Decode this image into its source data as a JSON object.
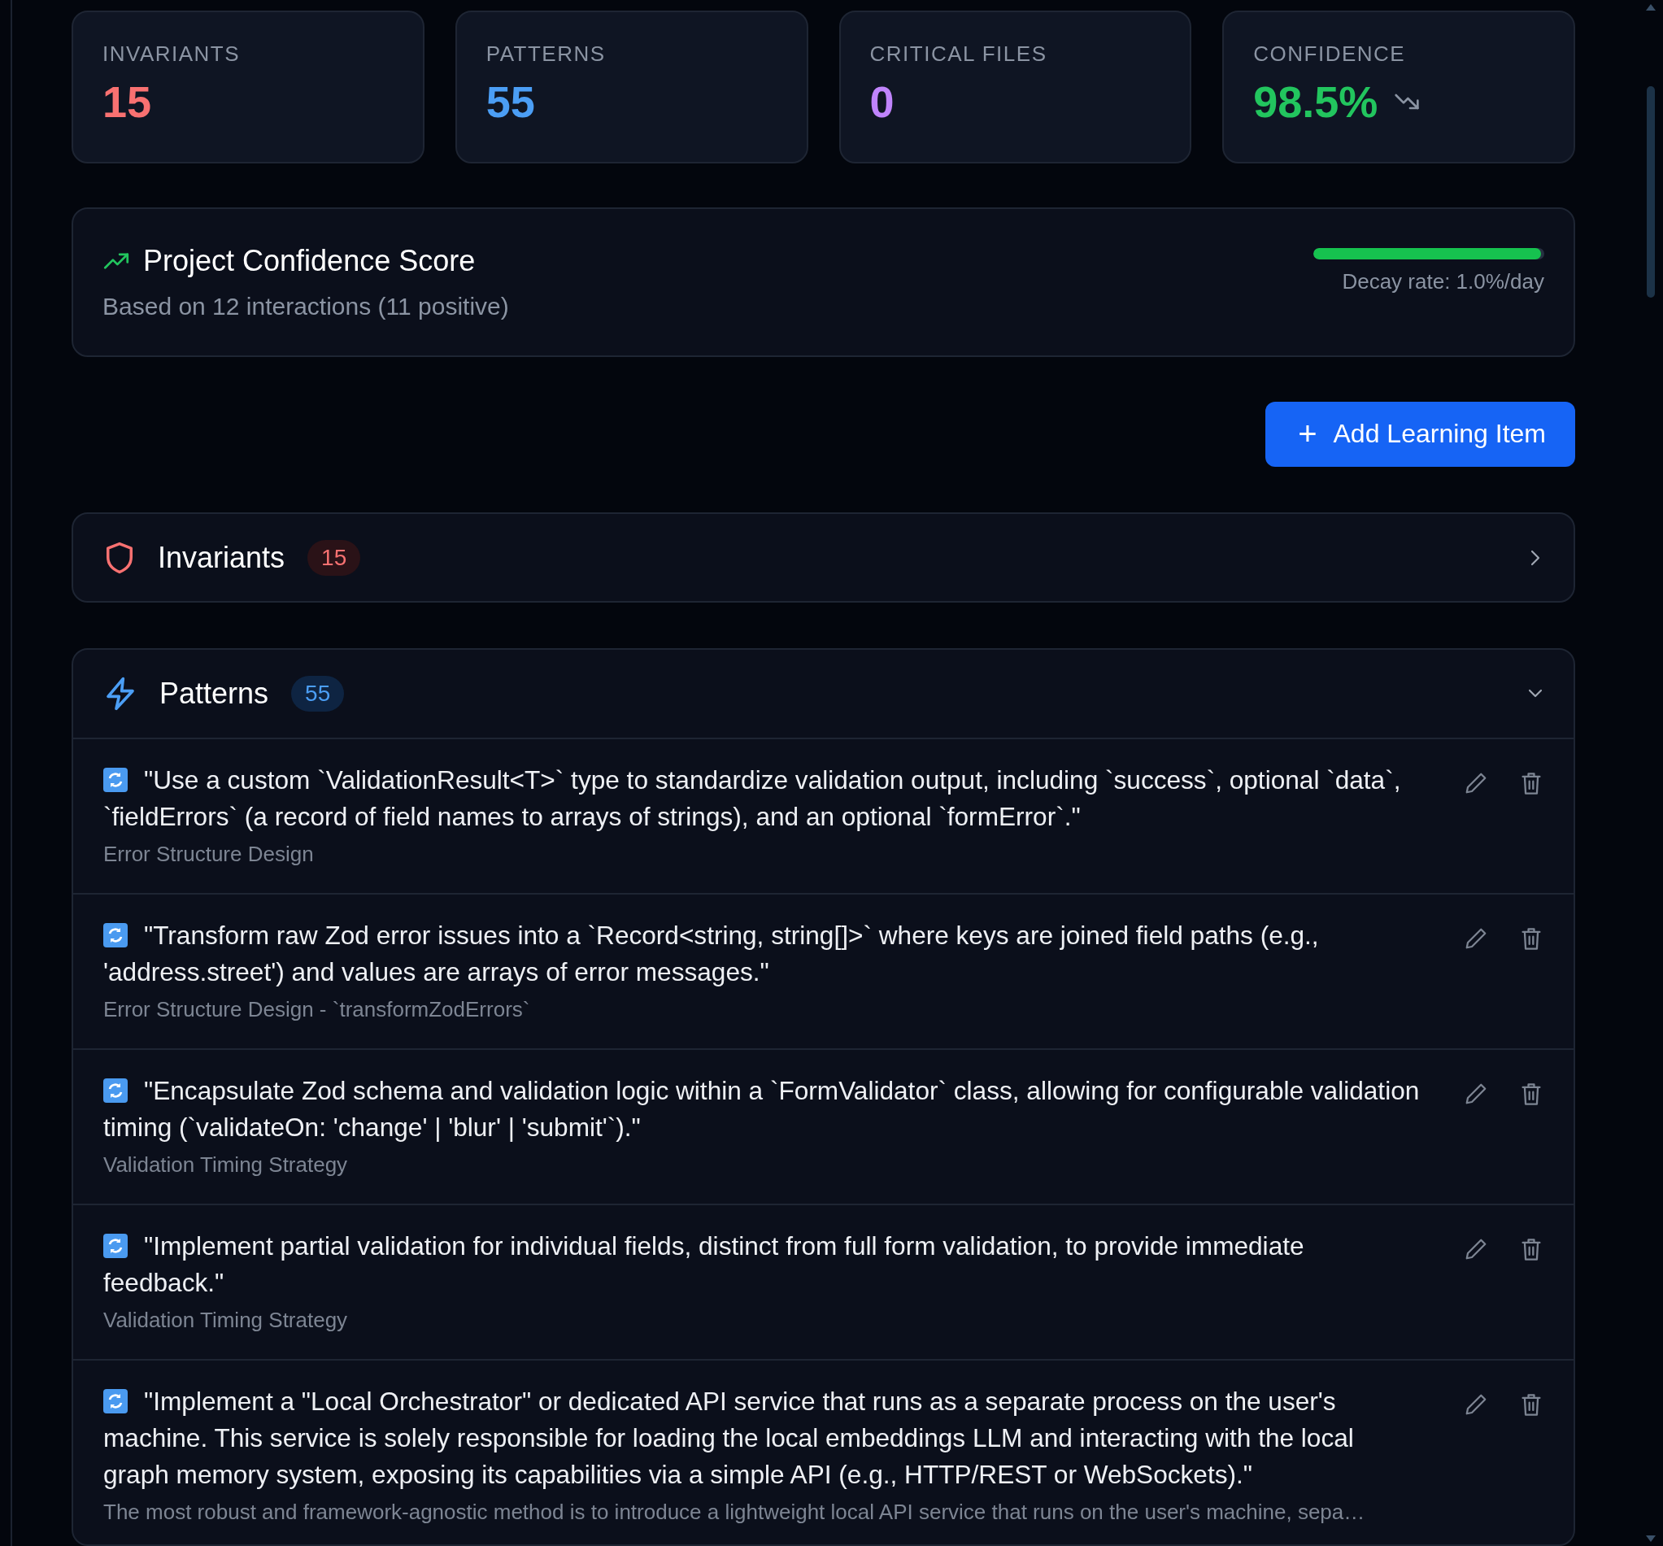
{
  "stats": [
    {
      "label": "INVARIANTS",
      "value": "15",
      "color": "#f87171"
    },
    {
      "label": "PATTERNS",
      "value": "55",
      "color": "#4b9ef5"
    },
    {
      "label": "CRITICAL FILES",
      "value": "0",
      "color": "#c084fc"
    },
    {
      "label": "CONFIDENCE",
      "value": "98.5%",
      "color": "#22c55e",
      "decaying": true
    }
  ],
  "confidence": {
    "title": "Project Confidence Score",
    "subtitle": "Based on 12 interactions (11 positive)",
    "level": 0.985,
    "decay": "Decay rate: 1.0%/day"
  },
  "add_button": {
    "icon": "+",
    "label": "Add Learning Item"
  },
  "sections": [
    {
      "kind": "invariants",
      "title": "Invariants",
      "count": "15",
      "expanded": false
    },
    {
      "kind": "patterns",
      "title": "Patterns",
      "count": "55",
      "expanded": true,
      "items": [
        {
          "text": "\"Use a custom `ValidationResult<T>` type to standardize validation output, including `success`, optional `data`, `fieldErrors` (a record of field names to arrays of strings), and an optional `formError`.\"",
          "source": "Error Structure Design"
        },
        {
          "text": "\"Transform raw Zod error issues into a `Record<string, string[]>` where keys are joined field paths (e.g., 'address.street') and values are arrays of error messages.\"",
          "source": "Error Structure Design - `transformZodErrors`"
        },
        {
          "text": "\"Encapsulate Zod schema and validation logic within a `FormValidator` class, allowing for configurable validation timing (`validateOn: 'change' | 'blur' | 'submit'`).\"",
          "source": "Validation Timing Strategy"
        },
        {
          "text": "\"Implement partial validation for individual fields, distinct from full form validation, to provide immediate feedback.\"",
          "source": "Validation Timing Strategy"
        },
        {
          "text": "\"Implement a \"Local Orchestrator\" or dedicated API service that runs as a separate process on the user's machine. This service is solely responsible for loading the local embeddings LLM and interacting with the local graph memory system, exposing its capabilities via a simple API (e.g., HTTP/REST or WebSockets).\"",
          "source": "The most robust and framework-agnostic method is to introduce a lightweight local API service that runs on the user's machine, sepa…"
        }
      ]
    }
  ]
}
